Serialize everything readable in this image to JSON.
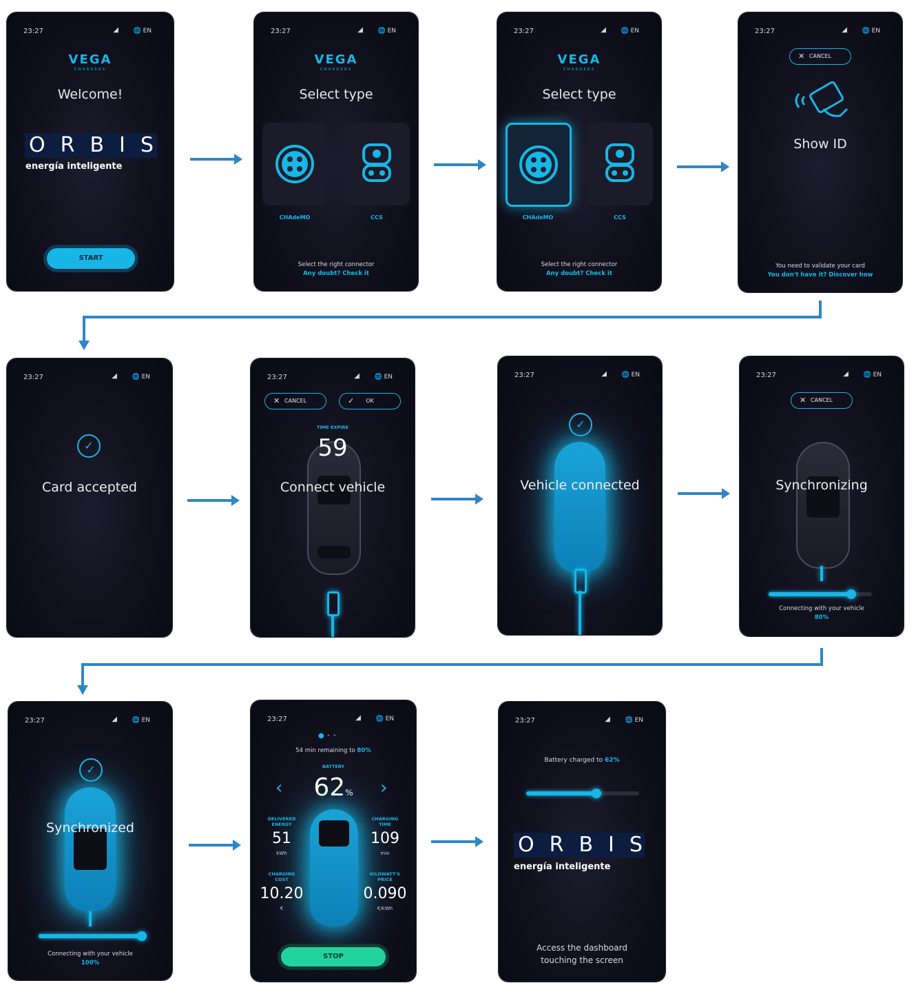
{
  "status": {
    "time": "23:27",
    "lang": "EN",
    "signal": "◣"
  },
  "brand": {
    "vega": "VEGA",
    "vega_sub": "CHARGERS",
    "orbis": "ORBIS",
    "orbis_mark": "°",
    "orbis_tagline": "energía inteligente"
  },
  "welcome": {
    "title": "Welcome!",
    "start": "START"
  },
  "select": {
    "title": "Select type",
    "connectors": [
      "CHAdeMO",
      "CCS"
    ],
    "footer_1": "Select the right connector",
    "footer_2": "Any doubt? Check it"
  },
  "show_id": {
    "cancel": "CANCEL",
    "title": "Show ID",
    "footer_1": "You need to validate your card",
    "footer_2": "You don't have it? Discover how"
  },
  "card": {
    "title": "Card accepted"
  },
  "connect": {
    "cancel": "CANCEL",
    "ok": "OK",
    "timer_label": "TIME EXPIRE",
    "timer": "59",
    "title": "Connect vehicle"
  },
  "connected": {
    "title": "Vehicle connected"
  },
  "sync": {
    "cancel": "CANCEL",
    "title": "Synchronizing",
    "caption": "Connecting with your vehicle",
    "percent": "80%",
    "progress": 0.8
  },
  "synced": {
    "title": "Synchronized",
    "caption": "Connecting with your vehicle",
    "percent": "100%",
    "progress": 1.0
  },
  "dashboard": {
    "remaining_prefix": "54 min remaining to",
    "remaining_target": "80%",
    "battery_label": "BATTERY",
    "battery": "62",
    "battery_unit": "%",
    "prev": "‹",
    "next": "›",
    "metrics": [
      {
        "label_1": "DELIVERED",
        "label_2": "ENERGY",
        "value": "51",
        "unit": "kWh"
      },
      {
        "label_1": "CHARGING",
        "label_2": "TIME",
        "value": "109",
        "unit": "min"
      },
      {
        "label_1": "CHARGING",
        "label_2": "COST",
        "value": "10.20",
        "unit": "€"
      },
      {
        "label_1": "KILOWATT'S",
        "label_2": "PRICE",
        "value": "0.090",
        "unit": "€/kWh"
      }
    ],
    "stop": "STOP"
  },
  "final": {
    "charged_prefix": "Battery charged to",
    "charged_value": "62%",
    "progress": 0.62,
    "access_1": "Access the dashboard",
    "access_2": "touching the screen"
  },
  "colors": {
    "accent": "#18b6e6",
    "stop": "#22d3a0",
    "arrow": "#2f86c6",
    "screen": "#10101c"
  }
}
